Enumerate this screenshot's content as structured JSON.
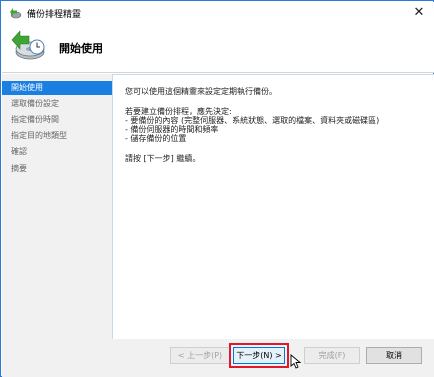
{
  "window": {
    "title": "備份排程精靈",
    "close_glyph": "✕"
  },
  "header": {
    "title": "開始使用",
    "icon": "backup-schedule-icon"
  },
  "sidebar": {
    "items": [
      {
        "label": "開始使用",
        "active": true
      },
      {
        "label": "選取備份設定",
        "active": false
      },
      {
        "label": "指定備份時間",
        "active": false
      },
      {
        "label": "指定目的地類型",
        "active": false
      },
      {
        "label": "確認",
        "active": false
      },
      {
        "label": "摘要",
        "active": false
      }
    ]
  },
  "content": {
    "intro": "您可以使用這個精靈來設定定期執行備份。",
    "decide_heading": "若要建立備份排程，應先決定:",
    "bullets": [
      "- 要備份的內容 (完整伺服器、系統狀態、選取的檔案、資料夾或磁碟區)",
      "- 備份伺服器的時間和頻率",
      "- 儲存備份的位置"
    ],
    "continue_text": "請按 [下一步] 繼續。"
  },
  "footer": {
    "prev_label": "< 上一步(P)",
    "next_label": "下一步(N) >",
    "finish_label": "完成(F)",
    "cancel_label": "取消"
  },
  "colors": {
    "accent": "#1a7fe0",
    "highlight": "#e0182a",
    "window_border": "#2b7bd6"
  }
}
